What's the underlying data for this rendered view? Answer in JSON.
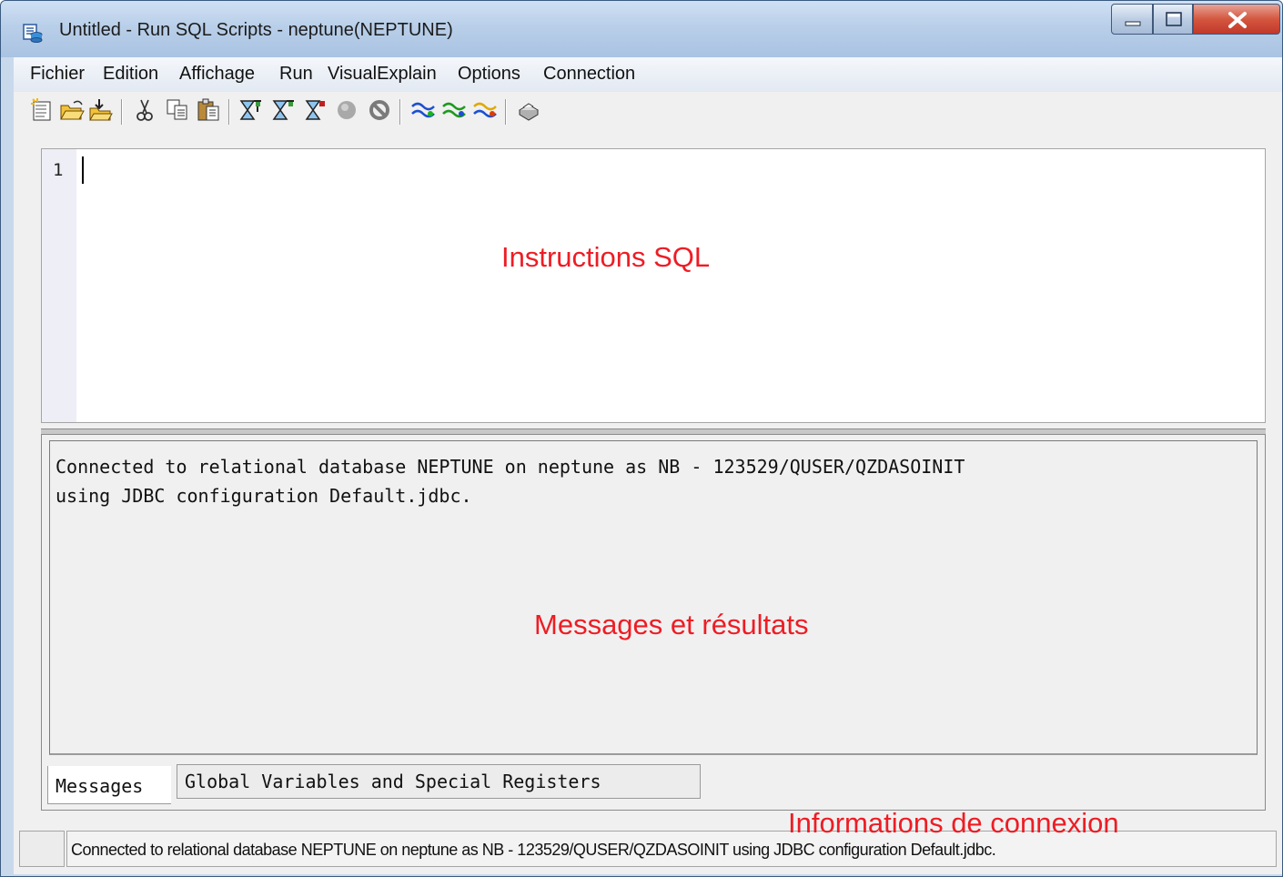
{
  "window": {
    "title": "Untitled - Run SQL Scripts - neptune(NEPTUNE)",
    "app_icon": "database-script-icon",
    "controls": [
      "minimize-icon",
      "maximize-icon",
      "close-icon"
    ]
  },
  "menubar": {
    "items": [
      {
        "label": "Fichier"
      },
      {
        "label": "Edition"
      },
      {
        "label": "Affichage"
      },
      {
        "label": "Run"
      },
      {
        "label": "VisualExplain"
      },
      {
        "label": "Options"
      },
      {
        "label": "Connection"
      }
    ]
  },
  "toolbar": {
    "buttons": [
      "new-icon",
      "open-icon",
      "save-icon",
      "cut-icon",
      "copy-icon",
      "paste-icon",
      "run-all-icon",
      "run-from-selected-icon",
      "run-selected-icon",
      "stop-circle-icon",
      "cancel-icon",
      "explain-icon",
      "run-and-explain-icon",
      "explain-options-icon",
      "print-icon"
    ]
  },
  "editor": {
    "line_number": "1",
    "content": ""
  },
  "annotations": {
    "editor_label": "Instructions SQL",
    "results_label": "Messages et résultats",
    "status_label": "Informations de connexion"
  },
  "results": {
    "message_lines": [
      "Connected to relational database NEPTUNE on neptune as NB - 123529/QUSER/QZDASOINIT",
      "using JDBC configuration Default.jdbc."
    ],
    "tabs": [
      {
        "label": "Messages",
        "active": true
      },
      {
        "label": "Global Variables and Special Registers",
        "active": false
      }
    ]
  },
  "statusbar": {
    "text": "Connected to relational database NEPTUNE on neptune as NB - 123529/QUSER/QZDASOINIT using JDBC configuration Default.jdbc."
  },
  "colors": {
    "annotation": "#ee1c24",
    "titlebar": "#b9cfe9",
    "close_button": "#d4573f",
    "client_bg": "#f0f0f0",
    "gutter_bg": "#eeeef7"
  }
}
